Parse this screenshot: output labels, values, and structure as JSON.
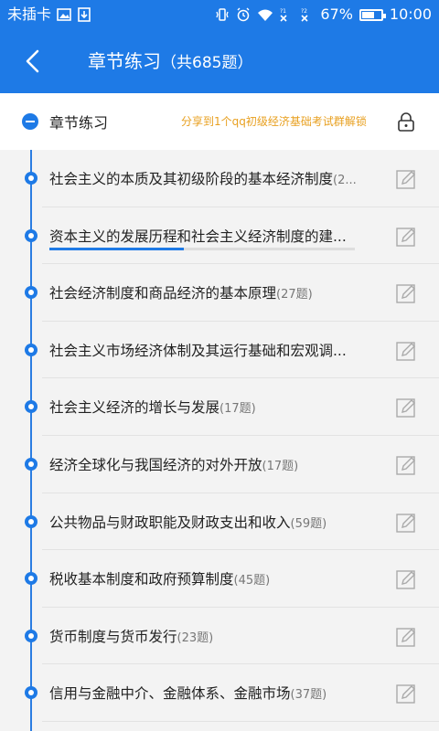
{
  "status_bar": {
    "carrier": "未插卡",
    "battery": "67%",
    "battery_level": 0.67,
    "time": "10:00"
  },
  "app_bar": {
    "title": "章节练习",
    "count": "（共685题）"
  },
  "header": {
    "title": "章节练习",
    "share_text": "分享到1个qq初级经济基础考试群解锁"
  },
  "chapters": [
    {
      "title": "社会主义的本质及其初级阶段的基本经济制度",
      "count": "(2..."
    },
    {
      "title": "资本主义的发展历程和社会主义经济制度的建...",
      "count": "",
      "progress": 0.44
    },
    {
      "title": "社会经济制度和商品经济的基本原理",
      "count": "(27题)"
    },
    {
      "title": "社会主义市场经济体制及其运行基础和宏观调...",
      "count": ""
    },
    {
      "title": "社会主义经济的增长与发展",
      "count": "(17题)"
    },
    {
      "title": "经济全球化与我国经济的对外开放",
      "count": "(17题)"
    },
    {
      "title": "公共物品与财政职能及财政支出和收入",
      "count": "(59题)"
    },
    {
      "title": "税收基本制度和政府预算制度",
      "count": "(45题)"
    },
    {
      "title": "货币制度与货币发行",
      "count": "(23题)"
    },
    {
      "title": "信用与金融中介、金融体系、金融市场",
      "count": "(37题)"
    }
  ]
}
